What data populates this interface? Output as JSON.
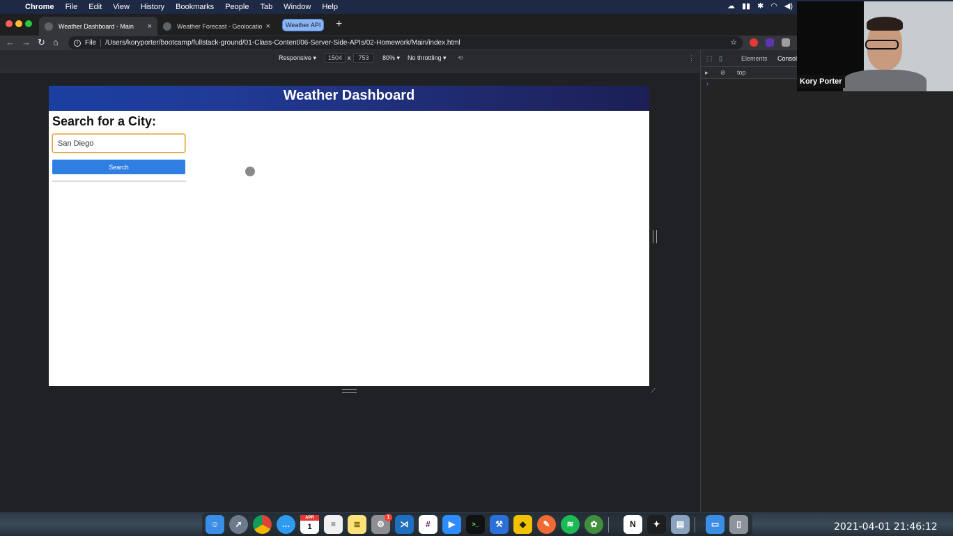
{
  "menubar": {
    "app": "Chrome",
    "items": [
      "File",
      "Edit",
      "View",
      "History",
      "Bookmarks",
      "People",
      "Tab",
      "Window",
      "Help"
    ]
  },
  "tabs": [
    {
      "title": "Weather Dashboard - Main",
      "close": "×"
    },
    {
      "title": "Weather Forecast - Geolocatio",
      "close": "×"
    }
  ],
  "tab_group": "Weather API",
  "new_tab": "+",
  "omnibox": {
    "scheme": "File",
    "url": "/Users/koryporter/bootcamp/fullstack-ground/01-Class-Content/06-Server-Side-APIs/02-Homework/Main/index.html"
  },
  "device_toolbar": {
    "device": "Responsive ▾",
    "width": "1504",
    "times": "x",
    "height": "753",
    "zoom": "80% ▾",
    "throttle": "No throttling ▾"
  },
  "page": {
    "header_title": "Weather Dashboard",
    "search_heading": "Search for a City:",
    "input_value": "San Diego",
    "search_button": "Search"
  },
  "devtools": {
    "tabs": [
      "Elements",
      "Console"
    ],
    "context": "top",
    "prompt": "›"
  },
  "webcam": {
    "name": "Kory Porter"
  },
  "dock": {
    "calendar_month": "APR",
    "calendar_day": "1",
    "badge": "1"
  },
  "clock": "2021-04-01  21:46:12",
  "colors": {
    "header_gradient_start": "#1b3fa0",
    "header_gradient_end": "#1c1f55",
    "search_button": "#2f7fe3",
    "input_focus_border": "#e0a040"
  }
}
